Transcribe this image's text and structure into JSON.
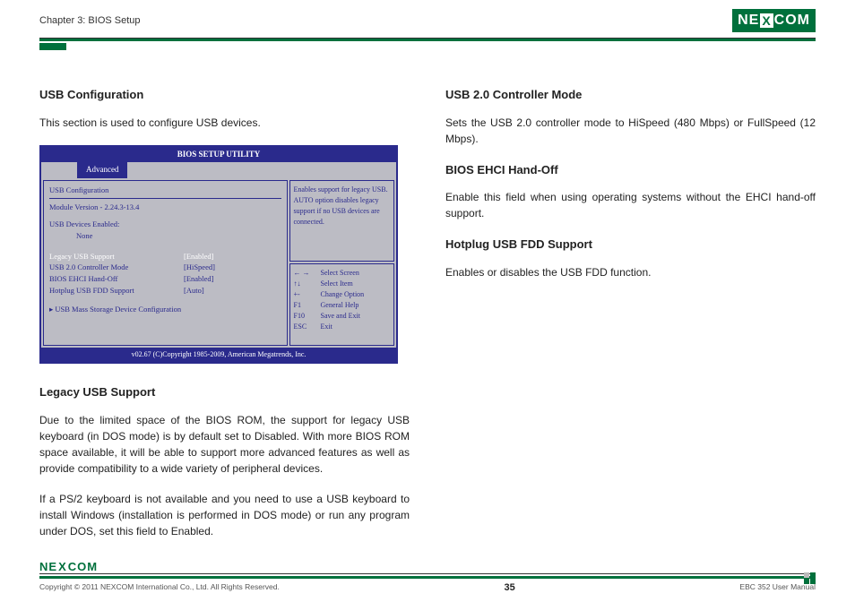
{
  "header": {
    "chapter": "Chapter 3: BIOS Setup",
    "logo_left": "NE",
    "logo_x": "X",
    "logo_right": "COM"
  },
  "left": {
    "h1": "USB Configuration",
    "p1": "This section is used to configure USB devices.",
    "h2": "Legacy USB Support",
    "p2": "Due to the limited space of the BIOS ROM, the support for legacy USB keyboard (in DOS mode) is by default set to Disabled. With more BIOS ROM space available, it will be able to support more advanced features as well as provide compatibility to a wide variety of peripheral devices.",
    "p3": "If a PS/2 keyboard is not available and you need to use a USB keyboard to install Windows (installation is performed in DOS mode) or run any program under DOS, set this field to Enabled."
  },
  "right": {
    "h1": "USB 2.0 Controller Mode",
    "p1": "Sets the USB 2.0 controller mode to HiSpeed (480 Mbps) or FullSpeed (12 Mbps).",
    "h2": "BIOS EHCI Hand-Off",
    "p2": "Enable this field when using operating systems without the EHCI hand-off support.",
    "h3": "Hotplug USB FDD Support",
    "p3": "Enables or disables the USB FDD function."
  },
  "bios": {
    "title": "BIOS SETUP UTILITY",
    "tab": "Advanced",
    "section": "USB Configuration",
    "module_label": "Module Version - 2.24.3-13.4",
    "devices_label": "USB Devices Enabled:",
    "devices_value": "None",
    "rows": [
      {
        "label": "Legacy USB Support",
        "value": "[Enabled]",
        "hl": true
      },
      {
        "label": "USB 2.0 Controller Mode",
        "value": "[HiSpeed]",
        "hl": false
      },
      {
        "label": "BIOS EHCI Hand-Off",
        "value": "[Enabled]",
        "hl": false
      },
      {
        "label": "Hotplug USB FDD Support",
        "value": "[Auto]",
        "hl": false
      }
    ],
    "submenu": "▸  USB Mass Storage Device Configuration",
    "help": "Enables support for legacy USB. AUTO option disables legacy support if no USB devices are connected.",
    "keys": [
      {
        "k": "← →",
        "d": "Select Screen"
      },
      {
        "k": "↑↓",
        "d": "Select Item"
      },
      {
        "k": "+-",
        "d": "Change Option"
      },
      {
        "k": "F1",
        "d": "General Help"
      },
      {
        "k": "F10",
        "d": "Save and Exit"
      },
      {
        "k": "ESC",
        "d": "Exit"
      }
    ],
    "footer": "v02.67 (C)Copyright 1985-2009, American Megatrends, Inc."
  },
  "footer": {
    "copyright": "Copyright © 2011 NEXCOM International Co., Ltd. All Rights Reserved.",
    "page": "35",
    "manual": "EBC 352 User Manual"
  }
}
